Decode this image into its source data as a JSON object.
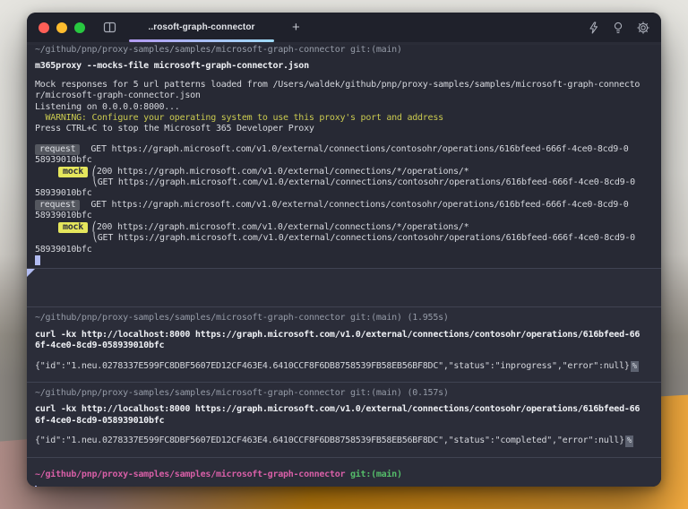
{
  "window": {
    "tab_title": "..rosoft-graph-connector",
    "new_tab_label": "+"
  },
  "colors": {
    "terminal_bg": "#2a2c37",
    "titlebar_bg": "#1f212b",
    "tab_underline_gradient": [
      "#b29af2",
      "#9edaf6"
    ],
    "prompt_grey": "#959ba7",
    "warning_yellow": "#caca50",
    "mock_badge_bg": "#e5e65c",
    "request_badge_bg": "#54575f",
    "prompt_pink": "#d85fa7",
    "git_green": "#55bd6a",
    "cursor": "#b1bbf1"
  },
  "terminal": {
    "proxy_block": {
      "prompt": "~/github/pnp/proxy-samples/samples/microsoft-graph-connector git:(main)",
      "command": "m365proxy --mocks-file microsoft-graph-connector.json",
      "loaded_line1": "Mock responses for 5 url patterns loaded from /Users/waldek/github/pnp/proxy-samples/samples/microsoft-graph-connecto",
      "loaded_line2": "r/microsoft-graph-connector.json",
      "listening": "Listening on 0.0.0.0:8000...",
      "warning": "  WARNING: Configure your operating system to use this proxy's port and address",
      "press_ctrlc": "Press CTRL+C to stop the Microsoft 365 Developer Proxy",
      "request_badge": "request",
      "mock_badge": "mock",
      "bracket_top": "⎛",
      "bracket_bottom": "⎝",
      "request_url_line1": "GET https://graph.microsoft.com/v1.0/external/connections/contosohr/operations/616bfeed-666f-4ce0-8cd9-0",
      "request_url_line2": "58939010bfc",
      "mock_pattern": "200 https://graph.microsoft.com/v1.0/external/connections/*/operations/*",
      "mock_url_line1": "GET https://graph.microsoft.com/v1.0/external/connections/contosohr/operations/616bfeed-666f-4ce0-8cd9-0",
      "mock_url_line2": "58939010bfc"
    },
    "curl_block1": {
      "prompt": "~/github/pnp/proxy-samples/samples/microsoft-graph-connector git:(main) (1.955s)",
      "command_line1": "curl -kx http://localhost:8000 https://graph.microsoft.com/v1.0/external/connections/contosohr/operations/616bfeed-66",
      "command_line2": "6f-4ce0-8cd9-058939010bfc",
      "response": "{\"id\":\"1.neu.0278337E599FC8DBF5607ED12CF463E4.6410CCF8F6DB8758539FB58EB56BF8DC\",\"status\":\"inprogress\",\"error\":null}",
      "eol_marker": "%"
    },
    "curl_block2": {
      "prompt": "~/github/pnp/proxy-samples/samples/microsoft-graph-connector git:(main) (0.157s)",
      "command_line1": "curl -kx http://localhost:8000 https://graph.microsoft.com/v1.0/external/connections/contosohr/operations/616bfeed-66",
      "command_line2": "6f-4ce0-8cd9-058939010bfc",
      "response": "{\"id\":\"1.neu.0278337E599FC8DBF5607ED12CF463E4.6410CCF8F6DB8758539FB58EB56BF8DC\",\"status\":\"completed\",\"error\":null}",
      "eol_marker": "%"
    },
    "current_prompt": {
      "path": "~/github/pnp/proxy-samples/samples/microsoft-graph-connector",
      "git": " git:(main)"
    }
  }
}
